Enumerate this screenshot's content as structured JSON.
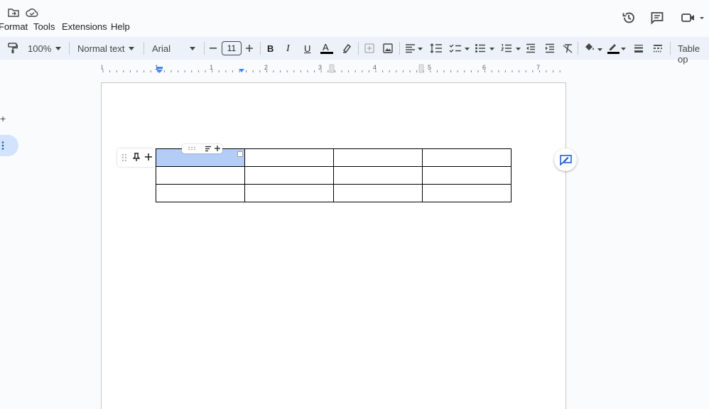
{
  "menu": {
    "format": "Format",
    "tools": "Tools",
    "extensions": "Extensions",
    "help": "Help"
  },
  "toolbar": {
    "zoom": "100%",
    "style": "Normal text",
    "font": "Arial",
    "font_size": "11",
    "bold": "B",
    "italic": "I",
    "underline": "U",
    "text_color": "A",
    "table_options": "Table op"
  },
  "ruler": {
    "labels": [
      "1",
      "1",
      "1",
      "2",
      "3",
      "4",
      "5",
      "6",
      "7"
    ]
  },
  "table": {
    "rows": [
      [
        "",
        "",
        "",
        ""
      ],
      [
        "",
        "",
        "",
        ""
      ],
      [
        "",
        "",
        "",
        ""
      ]
    ],
    "selected_cell": "row 1, column 1"
  },
  "colors": {
    "toolbar_bg": "#edf2fa",
    "accent": "#0b57d0",
    "selection": "#b4cdf7",
    "side_pill": "#d3e3fd"
  },
  "icons": [
    "folder-move-icon",
    "cloud-saved-icon",
    "history-icon",
    "comment-icon",
    "meet-icon",
    "paint-format-icon",
    "bold-icon",
    "italic-icon",
    "underline-icon",
    "highlight-icon",
    "insert-comment-icon",
    "insert-image-icon",
    "align-icon",
    "line-spacing-icon",
    "checklist-icon",
    "bullet-list-icon",
    "numbered-list-icon",
    "decrease-indent-icon",
    "increase-indent-icon",
    "clear-formatting-icon",
    "fill-color-icon",
    "border-color-icon",
    "border-width-icon",
    "border-dash-icon",
    "pin-icon",
    "add-comment-fab-icon"
  ]
}
